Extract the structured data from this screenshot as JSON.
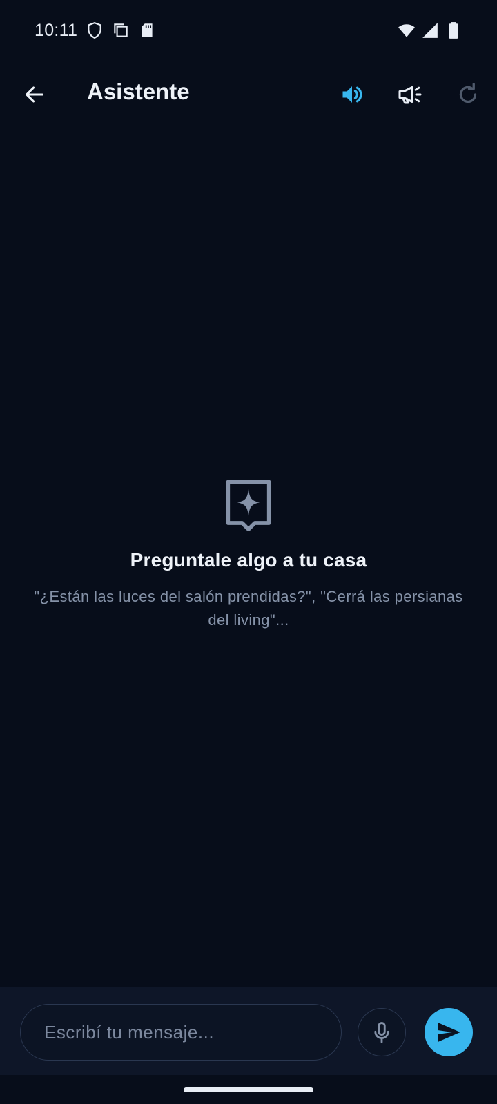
{
  "status_bar": {
    "time": "10:11",
    "icons": [
      "shield-icon",
      "copy-icon",
      "sd-card-icon",
      "wifi-icon",
      "signal-icon",
      "battery-icon"
    ]
  },
  "app_bar": {
    "title": "Asistente",
    "actions": [
      "volume-icon",
      "announcement-icon",
      "refresh-icon"
    ],
    "accent_color": "#38b6ee"
  },
  "empty_state": {
    "icon": "sparkle-chat-icon",
    "title": "Preguntale algo a tu casa",
    "subtitle": "\"¿Están las luces del salón prendidas?\", \"Cerrá las persianas del living\"..."
  },
  "composer": {
    "placeholder": "Escribí tu mensaje...",
    "value": "",
    "mic_icon": "microphone-icon",
    "send_icon": "send-icon"
  }
}
